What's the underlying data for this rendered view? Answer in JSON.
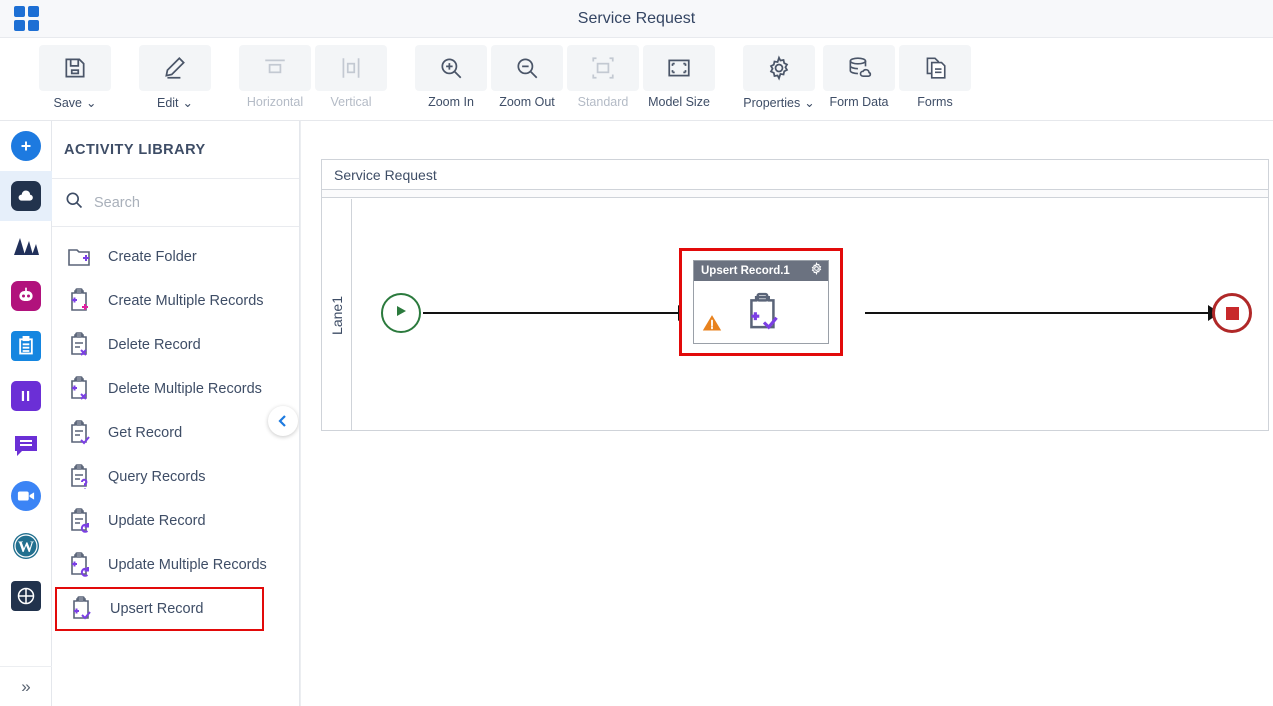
{
  "titlebar": {
    "app_grid_icon": "app-grid-icon",
    "title": "Service Request"
  },
  "toolbar": {
    "buttons": [
      {
        "label": "Save",
        "icon": "floppy-disk-icon",
        "caret": "⌄",
        "disabled": false
      },
      {
        "label": "Edit",
        "icon": "pencil-icon",
        "caret": "⌄",
        "disabled": false
      },
      {
        "label": "Horizontal",
        "icon": "horizontal-align-icon",
        "caret": "",
        "disabled": true
      },
      {
        "label": "Vertical",
        "icon": "vertical-align-icon",
        "caret": "",
        "disabled": true
      },
      {
        "label": "Zoom In",
        "icon": "zoom-in-icon",
        "caret": "",
        "disabled": false
      },
      {
        "label": "Zoom Out",
        "icon": "zoom-out-icon",
        "caret": "",
        "disabled": false
      },
      {
        "label": "Standard",
        "icon": "standard-size-icon",
        "caret": "",
        "disabled": true
      },
      {
        "label": "Model Size",
        "icon": "model-size-icon",
        "caret": "",
        "disabled": false
      },
      {
        "label": "Properties",
        "icon": "gear-icon",
        "caret": "⌄",
        "disabled": false
      },
      {
        "label": "Form Data",
        "icon": "database-cloud-icon",
        "caret": "",
        "disabled": false
      },
      {
        "label": "Forms",
        "icon": "documents-icon",
        "caret": "",
        "disabled": false
      }
    ]
  },
  "rail": {
    "items": [
      {
        "name": "add-button",
        "icon": "plus-circle-icon",
        "color": "#1d7ae0",
        "glyph": "+",
        "active": false
      },
      {
        "name": "nav-cloud-n",
        "icon": "cloud-n-icon",
        "color": "#22334d",
        "glyph": "☁",
        "active": true
      },
      {
        "name": "nav-analytics",
        "icon": "mountains-icon",
        "color": "#21305a",
        "glyph": "◤",
        "active": false
      },
      {
        "name": "nav-bot",
        "icon": "robot-icon",
        "color": "#b1127c",
        "glyph": "●",
        "active": false
      },
      {
        "name": "nav-clipboard",
        "icon": "clipboard-icon",
        "color": "#1586e0",
        "glyph": "☰",
        "active": false
      },
      {
        "name": "nav-columns",
        "icon": "columns-ii-icon",
        "color": "#6b2fd6",
        "glyph": "II",
        "active": false
      },
      {
        "name": "nav-chat",
        "icon": "chat-bubble-icon",
        "color": "#6b2fd6",
        "glyph": "=",
        "active": false
      },
      {
        "name": "nav-video",
        "icon": "video-camera-icon",
        "color": "#3b84f5",
        "glyph": "▶",
        "active": false
      },
      {
        "name": "nav-wordpress",
        "icon": "wordpress-icon",
        "color": "#22708f",
        "glyph": "W",
        "active": false
      },
      {
        "name": "nav-circle-grid",
        "icon": "circle-grid-icon",
        "color": "#22334d",
        "glyph": "⊕",
        "active": false
      }
    ],
    "expand_label": "»"
  },
  "panel": {
    "title": "ACTIVITY LIBRARY",
    "search_placeholder": "Search",
    "search_value": "",
    "search_icon": "search-icon",
    "collapse_icon": "chevron-left-icon",
    "items": [
      {
        "label": "Create Folder",
        "icon": "folder-plus-icon",
        "selected": false
      },
      {
        "label": "Create Multiple Records",
        "icon": "clipboard-plus-plus-icon",
        "selected": false
      },
      {
        "label": "Delete Record",
        "icon": "clipboard-x-icon",
        "selected": false
      },
      {
        "label": "Delete Multiple Records",
        "icon": "clipboard-plus-x-icon",
        "selected": false
      },
      {
        "label": "Get Record",
        "icon": "clipboard-check-icon",
        "selected": false
      },
      {
        "label": "Query Records",
        "icon": "clipboard-question-icon",
        "selected": false
      },
      {
        "label": "Update Record",
        "icon": "clipboard-refresh-icon",
        "selected": false
      },
      {
        "label": "Update Multiple Records",
        "icon": "clipboard-plus-refresh-icon",
        "selected": false
      },
      {
        "label": "Upsert Record",
        "icon": "clipboard-plus-check-icon",
        "selected": true
      }
    ]
  },
  "canvas": {
    "pool_label": "Service Request",
    "lane_label": "Lane1",
    "start_event": {
      "name": "start-event",
      "icon": "play-icon"
    },
    "end_event": {
      "name": "end-event",
      "icon": "stop-square-icon"
    },
    "task": {
      "name": "Upsert Record.1",
      "icon": "clipboard-plus-check-icon",
      "settings_icon": "gear-icon",
      "warning_icon": "warning-triangle-icon",
      "selected": true
    }
  },
  "colors": {
    "accent_blue": "#1d7ae0",
    "selection_red": "#e20a0a",
    "start_green": "#2b7a3d",
    "end_red": "#b02828",
    "task_header": "#6b7280",
    "warning_orange": "#e8821e",
    "icon_purple": "#7b3fe4"
  }
}
